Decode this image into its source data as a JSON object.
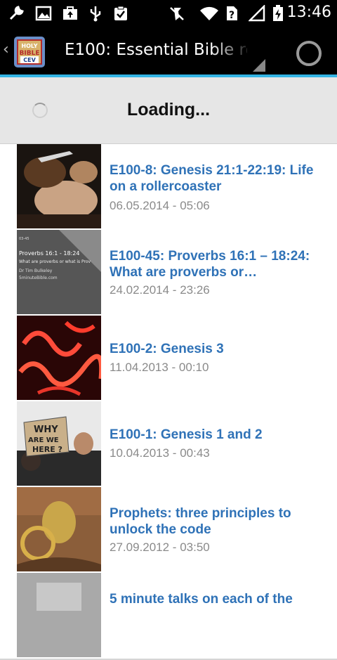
{
  "status_bar": {
    "time": "13:46",
    "icons": [
      "wrench-icon",
      "image-icon",
      "briefcase-upload-icon",
      "usb-icon",
      "clipboard-check-icon",
      "mute-icon",
      "wifi-icon",
      "sim-question-icon",
      "signal-icon",
      "battery-charging-icon"
    ]
  },
  "action_bar": {
    "title": "E100: Essential Bible re",
    "app_icon_text": [
      "HOLY",
      "BIBLE",
      "CEV"
    ]
  },
  "loading": {
    "label": "Loading..."
  },
  "list": [
    {
      "title": "E100-8: Genesis 21:1-22:19: Life on a rollercoaster",
      "date": "06.05.2014 - 05:06"
    },
    {
      "title": "E100-45: Proverbs 16:1 – 18:24: What are proverbs or…",
      "date": "24.02.2014 - 23:26",
      "thumb_text": [
        "03-45",
        "Proverbs 16:1 - 18:24",
        "What are proverbs or what is Prov",
        "Dr Tim Bulkeley",
        "5minuteBible.com"
      ]
    },
    {
      "title": "E100-2: Genesis 3",
      "date": "11.04.2013 - 00:10"
    },
    {
      "title": "E100-1: Genesis 1 and 2",
      "date": "10.04.2013 - 00:43",
      "thumb_text": [
        "WHY",
        "ARE WE",
        "HERE ?"
      ]
    },
    {
      "title": "Prophets: three principles to unlock the code",
      "date": "27.09.2012 - 03:50"
    },
    {
      "title": "5 minute talks on each of the",
      "date": ""
    }
  ],
  "colors": {
    "accent": "#33b5e5",
    "title_blue": "#2f72b7",
    "date_gray": "#8a8a8a"
  }
}
